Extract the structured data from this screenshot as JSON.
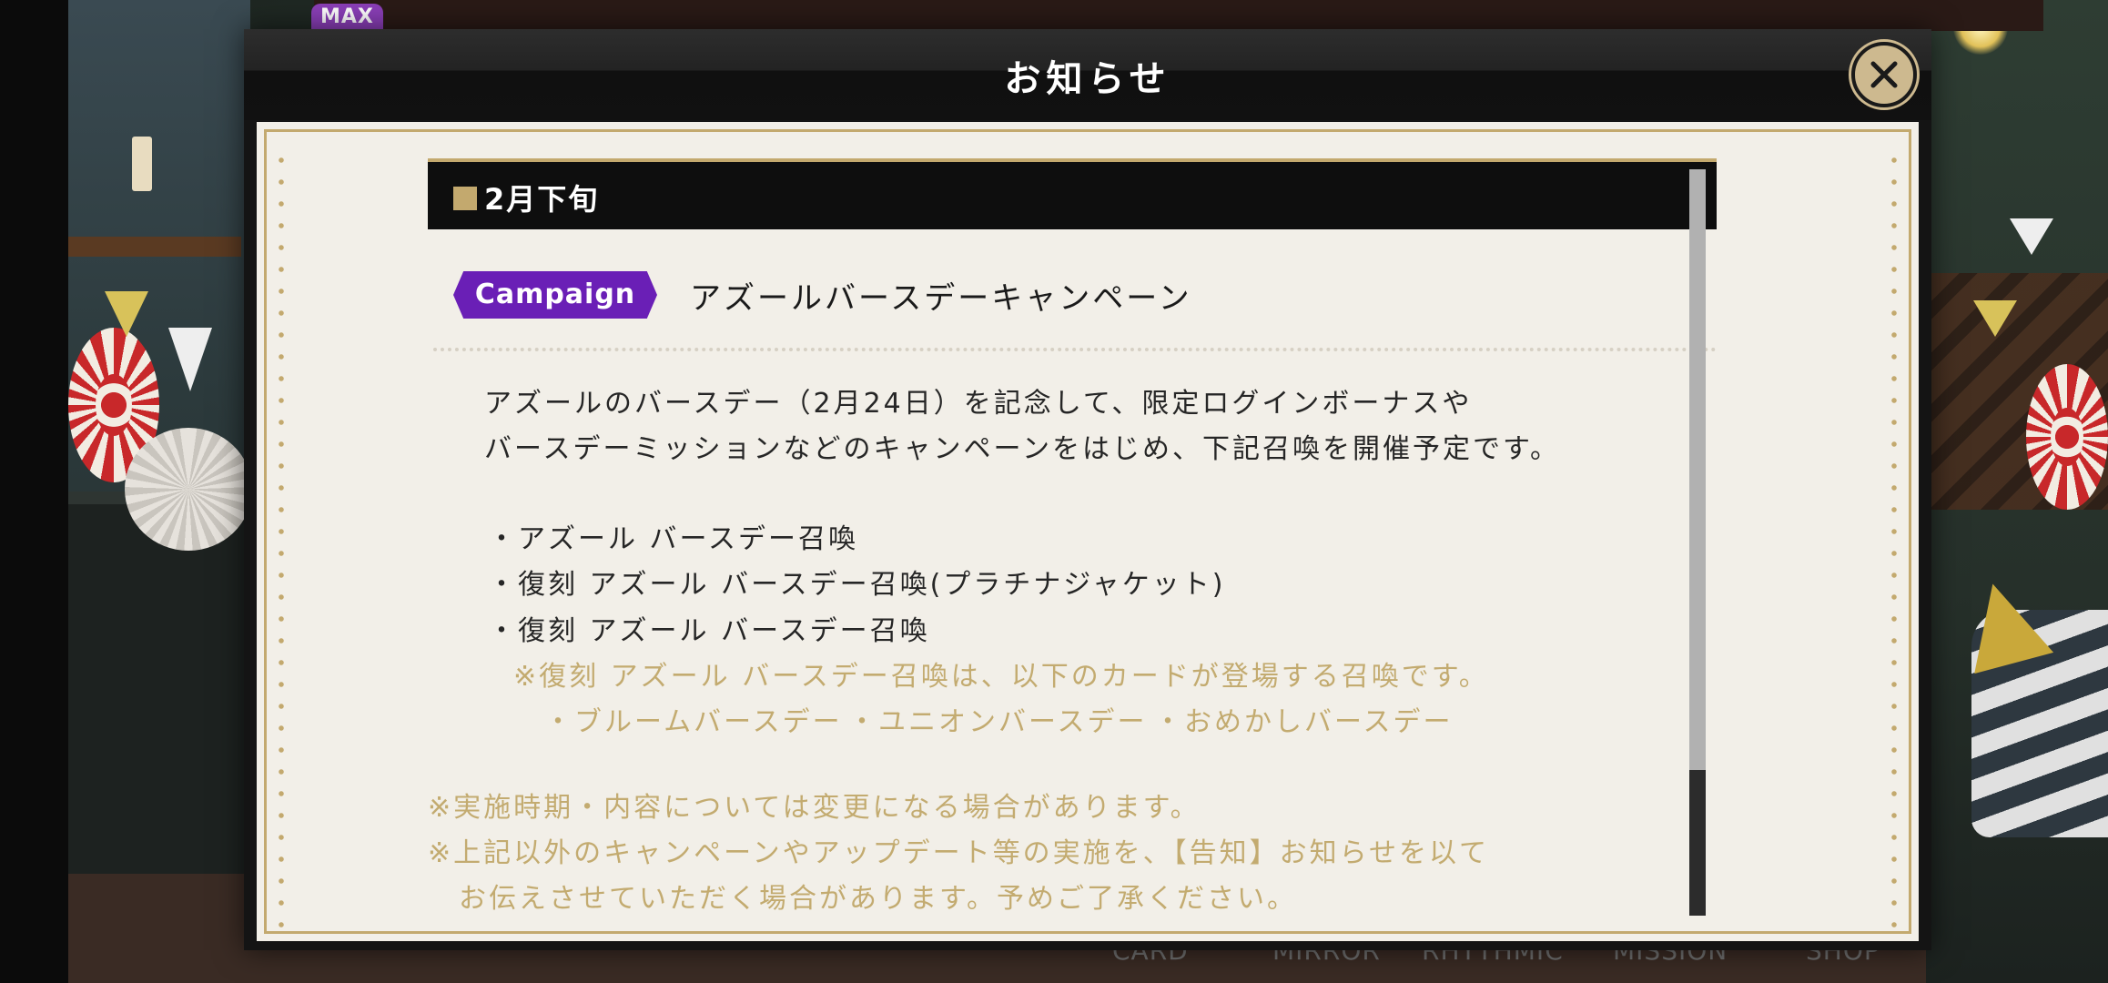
{
  "background": {
    "max_badge": "MAX",
    "bottom_nav": [
      "CARD",
      "MIRROR",
      "RHYTHMIC",
      "MISSION",
      "SHOP"
    ]
  },
  "modal": {
    "title": "お知らせ",
    "close_icon": "close-icon"
  },
  "notice": {
    "section_header": "2月下旬",
    "badge": "Campaign",
    "campaign_title": "アズールバースデーキャンペーン",
    "paragraph": [
      "アズールのバースデー（2月24日）を記念して、限定ログインボーナスや",
      "バースデーミッションなどのキャンペーンをはじめ、下記召喚を開催予定です。"
    ],
    "summons": [
      "・アズール バースデー召喚",
      "・復刻 アズール バースデー召喚(プラチナジャケット)",
      "・復刻 アズール バースデー召喚"
    ],
    "note": "※復刻 アズール バースデー召喚は、以下のカードが登場する召喚です。",
    "cards": [
      "・ブルームバースデー",
      "・ユニオンバースデー",
      "・おめかしバースデー"
    ],
    "disclaimers": [
      "※実施時期・内容については変更になる場合があります。",
      "※上記以外のキャンペーンやアップデート等の実施を、【告知】お知らせを以て",
      "お伝えさせていただく場合があります。予めご了承ください。"
    ]
  },
  "colors": {
    "gold": "#c3a96e",
    "badge_purple": "#6a1fb6",
    "paper": "#f2efe8"
  }
}
